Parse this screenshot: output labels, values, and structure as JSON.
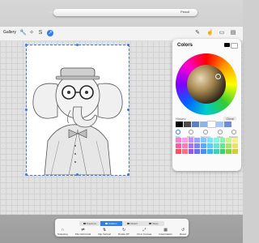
{
  "pencil": {
    "brand": "Pencil"
  },
  "toolbar": {
    "gallery_label": "Gallery",
    "icons": [
      "wrench-icon",
      "magic-wand-icon",
      "selection-icon",
      "transform-arrow-icon"
    ],
    "right_icons": [
      "brush-icon",
      "smudge-icon",
      "eraser-icon",
      "layers-icon"
    ]
  },
  "colors_panel": {
    "title": "Colors",
    "history_label": "History",
    "clear_label": "Clear",
    "history": [
      "#000000",
      "#4a4a4a",
      "#5b7fc4",
      "#8fb3e8",
      "#ffffff",
      "#a7c8f0",
      "#6c8ed6"
    ],
    "modes": [
      "Disc",
      "Classic",
      "Harmony",
      "Value",
      "Palettes"
    ],
    "active_mode": "Disc",
    "palette": [
      "#ff7bd5",
      "#ff9be0",
      "#c98bff",
      "#9aa5ff",
      "#82c5ff",
      "#7ee0ff",
      "#7ff5e3",
      "#86f5a8",
      "#c7f58a",
      "#f5f08a",
      "#ff5a9c",
      "#ff7ab8",
      "#b06bff",
      "#7a84ff",
      "#5aa8ff",
      "#56cfff",
      "#5fe8cf",
      "#5fe886",
      "#a8e85f",
      "#e8e25f",
      "#ff4f5f",
      "#ff6f7f",
      "#9a55e8",
      "#6a70e8",
      "#4a90e8",
      "#3ab8e8",
      "#3ad2b8",
      "#3ad266",
      "#88d23a",
      "#d2cc3a"
    ]
  },
  "transform_dock": {
    "segments": [
      "Freeform",
      "Uniform",
      "Distort",
      "Warp"
    ],
    "active_segment": "Uniform",
    "buttons": [
      {
        "label": "Snapping",
        "icon": "magnet-icon"
      },
      {
        "label": "Flip Horizontal",
        "icon": "flip-horizontal-icon"
      },
      {
        "label": "Flip Vertical",
        "icon": "flip-vertical-icon"
      },
      {
        "label": "Rotate 45°",
        "icon": "rotate-icon"
      },
      {
        "label": "Fit to Canvas",
        "icon": "fit-canvas-icon"
      },
      {
        "label": "Interpolation",
        "icon": "interpolation-icon"
      },
      {
        "label": "Reset",
        "icon": "reset-icon"
      }
    ]
  },
  "colors": {
    "accent": "#2f80ed",
    "selection": "#3a7bd5"
  }
}
